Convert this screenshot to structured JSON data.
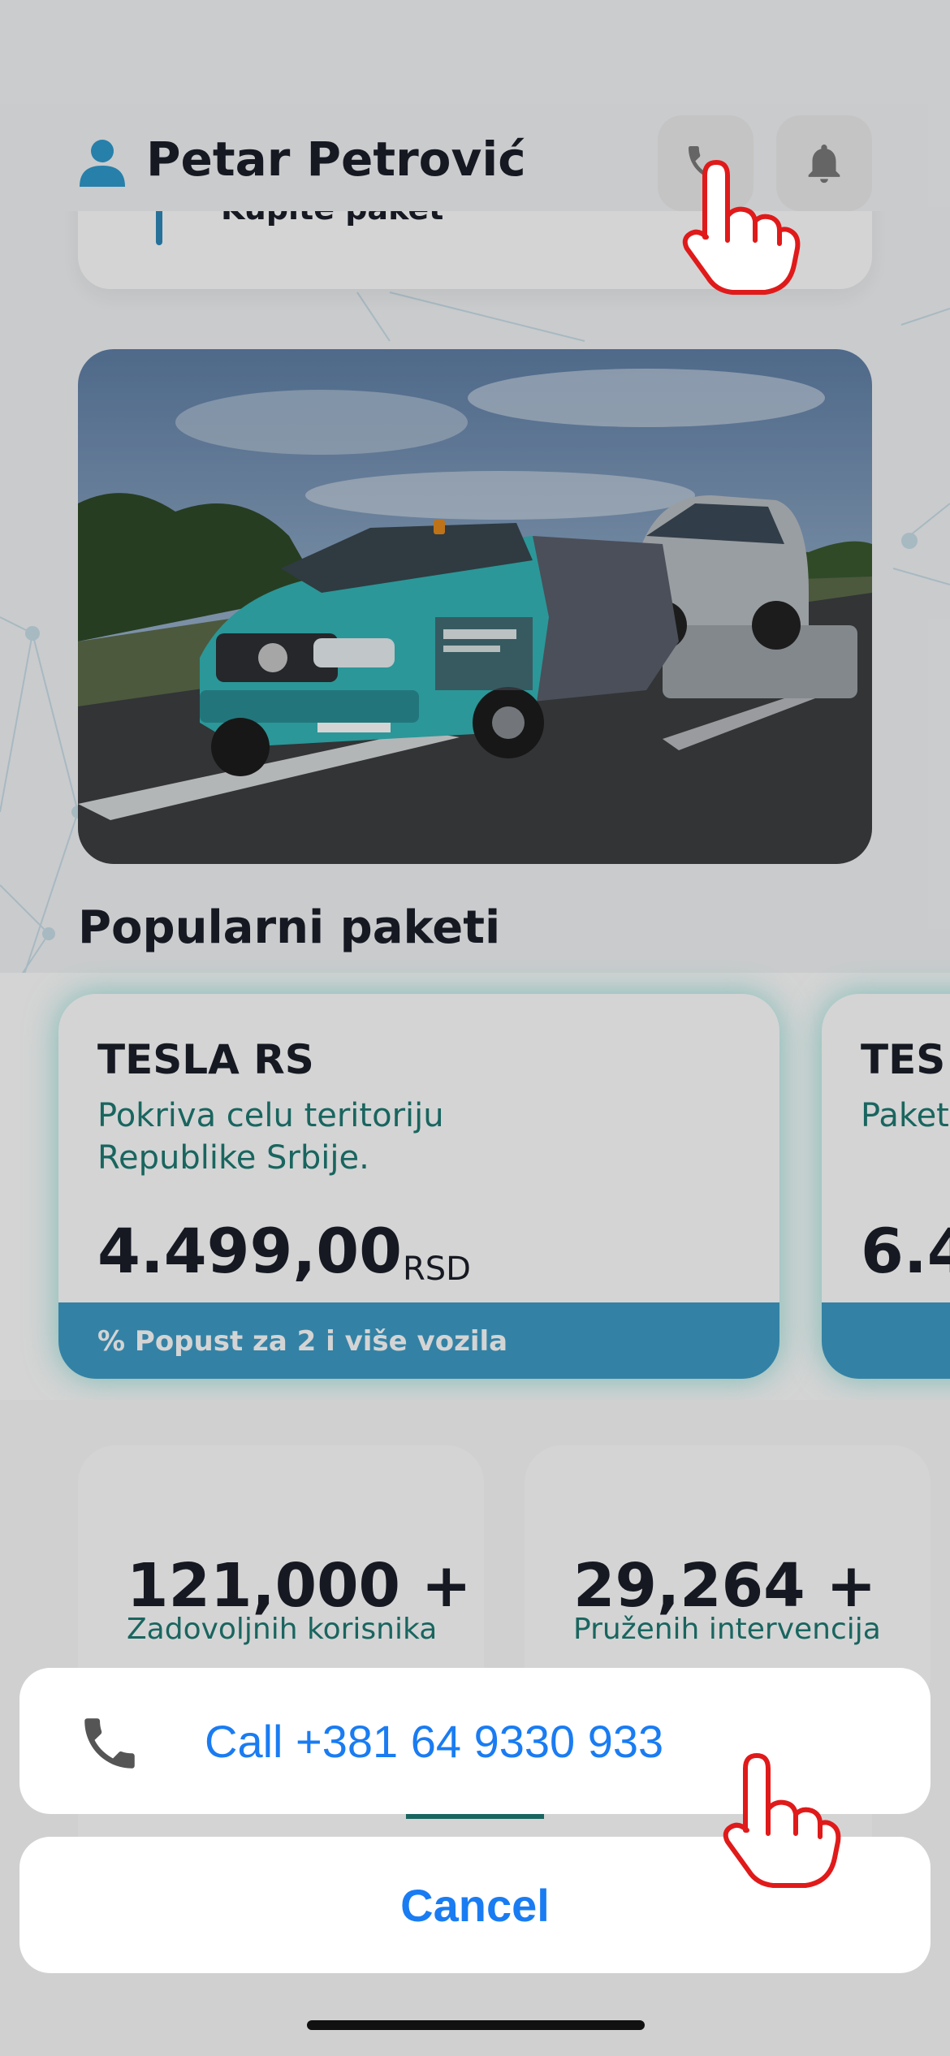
{
  "header": {
    "user_name": "Petar Petrović",
    "user_icon": "user-icon",
    "call_icon": "phone-icon",
    "notifications_icon": "bell-icon",
    "behind_card_text": "Kupite paket"
  },
  "hero": {
    "image_description_icon": "tow-truck-photo"
  },
  "popular": {
    "title": "Popularni paketi",
    "packages": [
      {
        "name": "TESLA RS",
        "description": "Pokriva celu teritoriju Republike Srbije.",
        "price": "4.499,00",
        "currency": "RSD",
        "footer": "% Popust za 2 i više vozila"
      },
      {
        "name": "TES",
        "description": "Paket",
        "price": "6.4",
        "currency": "",
        "footer": ""
      }
    ]
  },
  "stats": [
    {
      "value": "121,000 +",
      "label": "Zadovoljnih korisnika"
    },
    {
      "value": "29,264 +",
      "label": "Pruženih intervencija"
    }
  ],
  "action_sheet": {
    "call_label": "Call +381 64 9330 933",
    "cancel_label": "Cancel",
    "call_icon": "phone-icon"
  },
  "colors": {
    "accent_teal": "#1f7a73",
    "footer_blue": "#3e9dc7",
    "ios_blue": "#1a7cf2",
    "glow": "#3cc8be"
  }
}
